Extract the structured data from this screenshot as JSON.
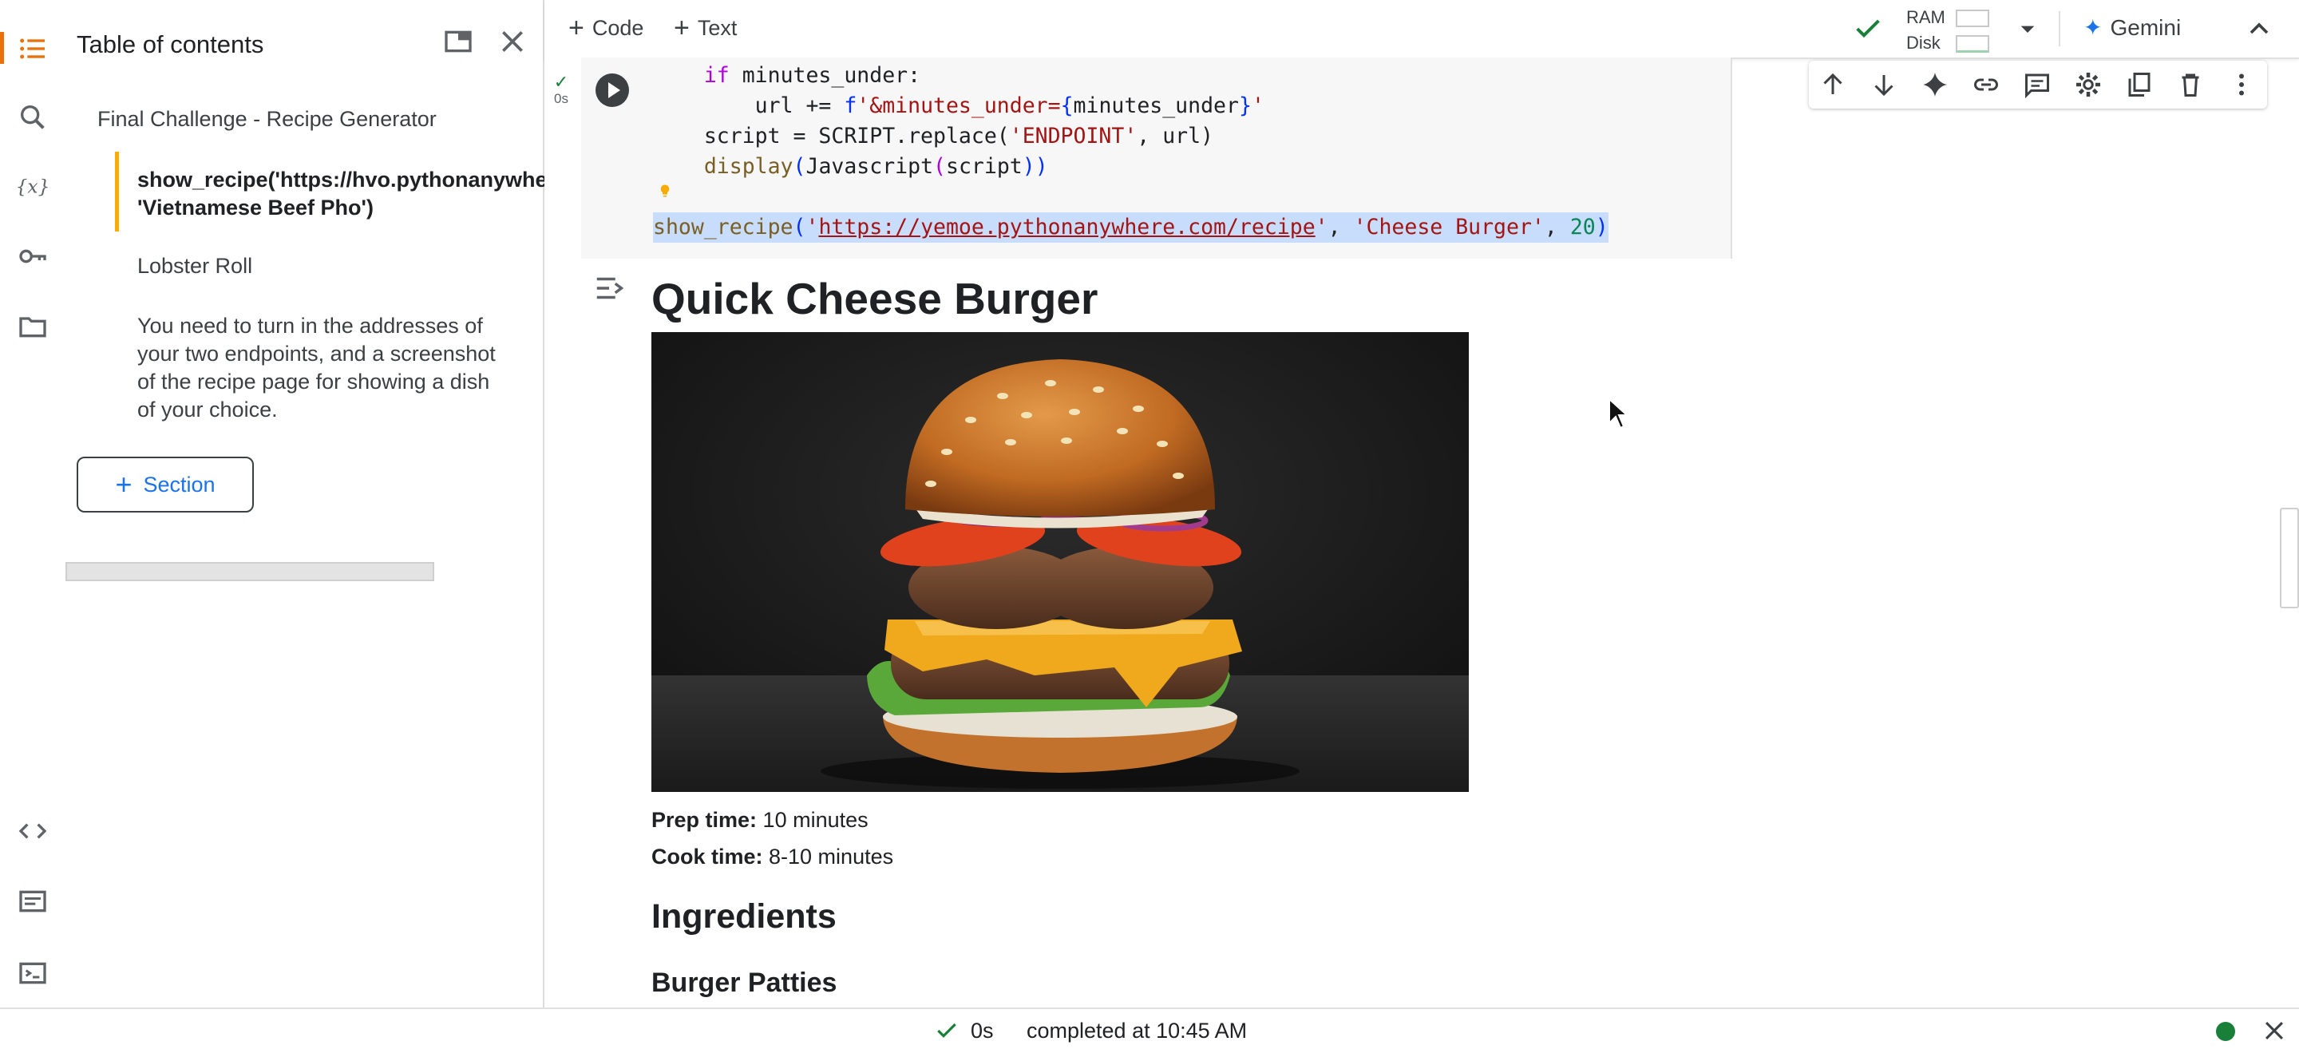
{
  "toc": {
    "title": "Table of contents",
    "items": [
      {
        "label": "Final Challenge - Recipe Generator"
      },
      {
        "label": "show_recipe('https://hvo.pythonanywhere\n'Vietnamese Beef Pho')"
      },
      {
        "label": "Lobster Roll"
      },
      {
        "label": "You need to turn in the addresses of your two endpoints, and a screenshot of the recipe page for showing a dish of your choice."
      }
    ],
    "section_button": "Section"
  },
  "toolbar": {
    "code_label": "Code",
    "text_label": "Text",
    "ram_label": "RAM",
    "disk_label": "Disk",
    "gemini_label": "Gemini"
  },
  "cell": {
    "exec_time": "0s",
    "lines": {
      "l1_kw": "if",
      "l1_rest": " minutes_under:",
      "l2_a": "    url += ",
      "l2_f": "f",
      "l2_str": "'&minutes_under=",
      "l2_b1": "{",
      "l2_mid": "minutes_under",
      "l2_b2": "}",
      "l2_end": "'",
      "l3_a": "script = SCRIPT.replace(",
      "l3_s1": "'ENDPOINT'",
      "l3_b": ", url)",
      "l4_fn": "display",
      "l4_p1": "(",
      "l4_mid": "Javascript",
      "l4_p2": "(",
      "l4_arg": "script",
      "l4_p3": "))",
      "l5_fn": "show_recipe",
      "l5_p1": "(",
      "l5_q1": "'",
      "l5_url": "https://yemoe.pythonanywhere.com/recipe",
      "l5_q2": "'",
      "l5_sep1": ", ",
      "l5_dish": "'Cheese Burger'",
      "l5_sep2": ", ",
      "l5_num": "20",
      "l5_p2": ")"
    }
  },
  "output": {
    "title": "Quick Cheese Burger",
    "image_alt": "Cheese burger with tomato, red onion, lettuce and melted cheese on a sesame bun",
    "prep_label": "Prep time:",
    "prep_value": " 10 minutes",
    "cook_label": "Cook time:",
    "cook_value": " 8-10 minutes",
    "ingredients_heading": "Ingredients",
    "patties_heading": "Burger Patties"
  },
  "status": {
    "time": "0s",
    "completed": "completed at 10:45 AM"
  },
  "colors": {
    "accent": "#1a73e8",
    "ok": "#188038",
    "toc_active": "#e8710a",
    "toc_selected": "#f9ab00"
  }
}
